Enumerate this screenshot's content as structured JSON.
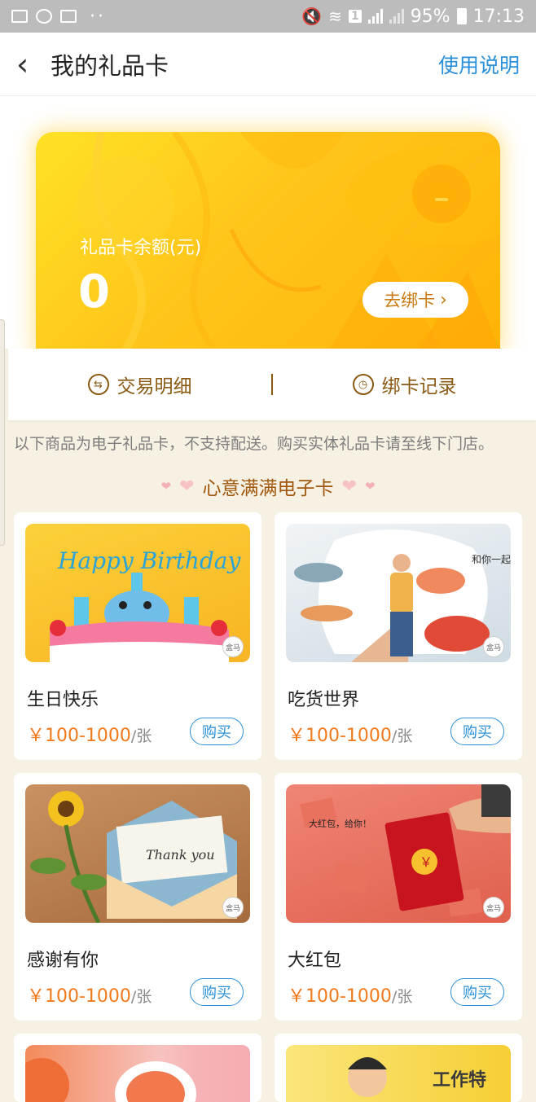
{
  "status_bar": {
    "battery": "95%",
    "time": "17:13",
    "sim_badge": "1",
    "left_icons": [
      "gallery-icon",
      "wechat-icon",
      "gallery-icon"
    ],
    "right_icons": [
      "mute-icon",
      "wifi-icon",
      "signal-icon",
      "battery-icon"
    ]
  },
  "nav": {
    "title": "我的礼品卡",
    "help_link": "使用说明"
  },
  "gift_card": {
    "balance_label": "礼品卡余额(元)",
    "balance": "0",
    "bind_button": "去绑卡",
    "colors": {
      "start": "#ffe226",
      "end": "#ffb308"
    }
  },
  "actions": {
    "transactions": "交易明细",
    "bind_history": "绑卡记录"
  },
  "notice": "以下商品为电子礼品卡，不支持配送。购买实体礼品卡请至线下门店。",
  "section_title": "心意满满电子卡",
  "products": [
    {
      "name": "生日快乐",
      "price": "￥100-1000",
      "unit": "/张",
      "buy": "购买",
      "art_text": "Happy Birthday",
      "colors": [
        "#fcc52e",
        "#f6a61a"
      ]
    },
    {
      "name": "吃货世界",
      "price": "￥100-1000",
      "unit": "/张",
      "buy": "购买",
      "art_text": "和你一起，尝鲜全世界",
      "colors": [
        "#e9eef2",
        "#c9d6df"
      ]
    },
    {
      "name": "感谢有你",
      "price": "￥100-1000",
      "unit": "/张",
      "buy": "购买",
      "art_text": "Thank you",
      "colors": [
        "#c48a57",
        "#a76a3a"
      ]
    },
    {
      "name": "大红包",
      "price": "￥100-1000",
      "unit": "/张",
      "buy": "购买",
      "art_text": "大红包，给你！",
      "colors": [
        "#ef8273",
        "#e4624f"
      ]
    }
  ],
  "partial_products": [
    {
      "art_text": "",
      "colors": [
        "#f7c3c0",
        "#f38a5a"
      ]
    },
    {
      "art_text": "工作特",
      "colors": [
        "#fbe57a",
        "#f6cf35"
      ]
    }
  ],
  "accent_colors": {
    "link_blue": "#2a8fd9",
    "price_orange": "#f07a1e",
    "brown": "#8a5a14"
  }
}
